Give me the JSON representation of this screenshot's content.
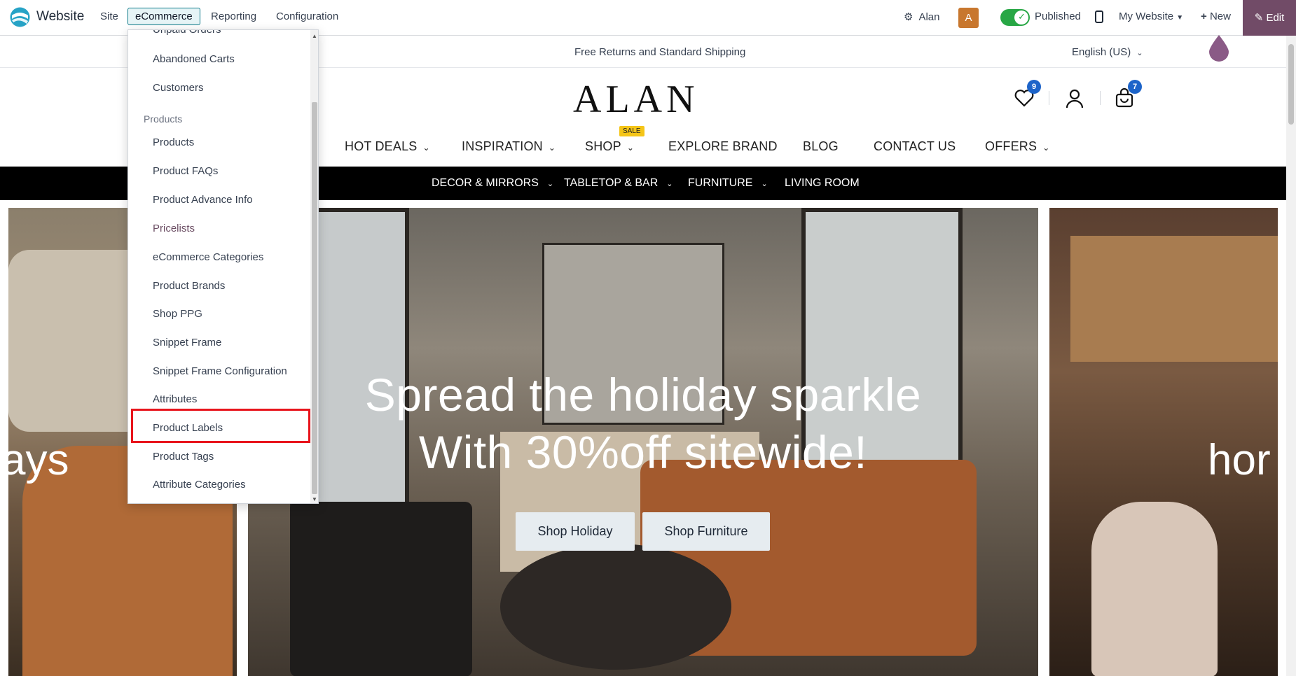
{
  "topbar": {
    "app_name": "Website",
    "menus": [
      "Site",
      "eCommerce",
      "Reporting",
      "Configuration"
    ],
    "user": "Alan",
    "avatar_letter": "A",
    "published_label": "Published",
    "website_selector": "My Website",
    "new_label": "New",
    "edit_label": "Edit"
  },
  "site": {
    "announcement": "Free Returns and Standard Shipping",
    "language": "English (US)",
    "brand": "ALAN",
    "wishlist_count": "9",
    "cart_count": "7",
    "nav": [
      "HOT DEALS",
      "INSPIRATION",
      "SHOP",
      "EXPLORE BRAND",
      "BLOG",
      "CONTACT US",
      "OFFERS"
    ],
    "sale_badge": "SALE",
    "subnav": [
      "DECOR & MIRRORS",
      "TABLETOP & BAR",
      "FURNITURE",
      "LIVING ROOM"
    ],
    "hero": {
      "line1": "Spread the holiday sparkle",
      "line2": "With 30%off sitewide!",
      "btn1": "Shop Holiday",
      "btn2": "Shop Furniture",
      "left_text": "ays",
      "right_text": "hor"
    }
  },
  "dropdown": {
    "cut_item": "Unpaid Orders",
    "items_top": [
      "Abandoned Carts",
      "Customers"
    ],
    "section_header": "Products",
    "items": [
      "Products",
      "Product FAQs",
      "Product Advance Info",
      "Pricelists",
      "eCommerce Categories",
      "Product Brands",
      "Shop PPG",
      "Snippet Frame",
      "Snippet Frame Configuration",
      "Attributes",
      "Product Labels",
      "Product Tags",
      "Attribute Categories"
    ],
    "highlighted": "Product Labels"
  },
  "colors": {
    "accent": "#714b67",
    "highlight": "#e8141c",
    "published_toggle": "#28a745",
    "badge": "#1d64c9"
  }
}
